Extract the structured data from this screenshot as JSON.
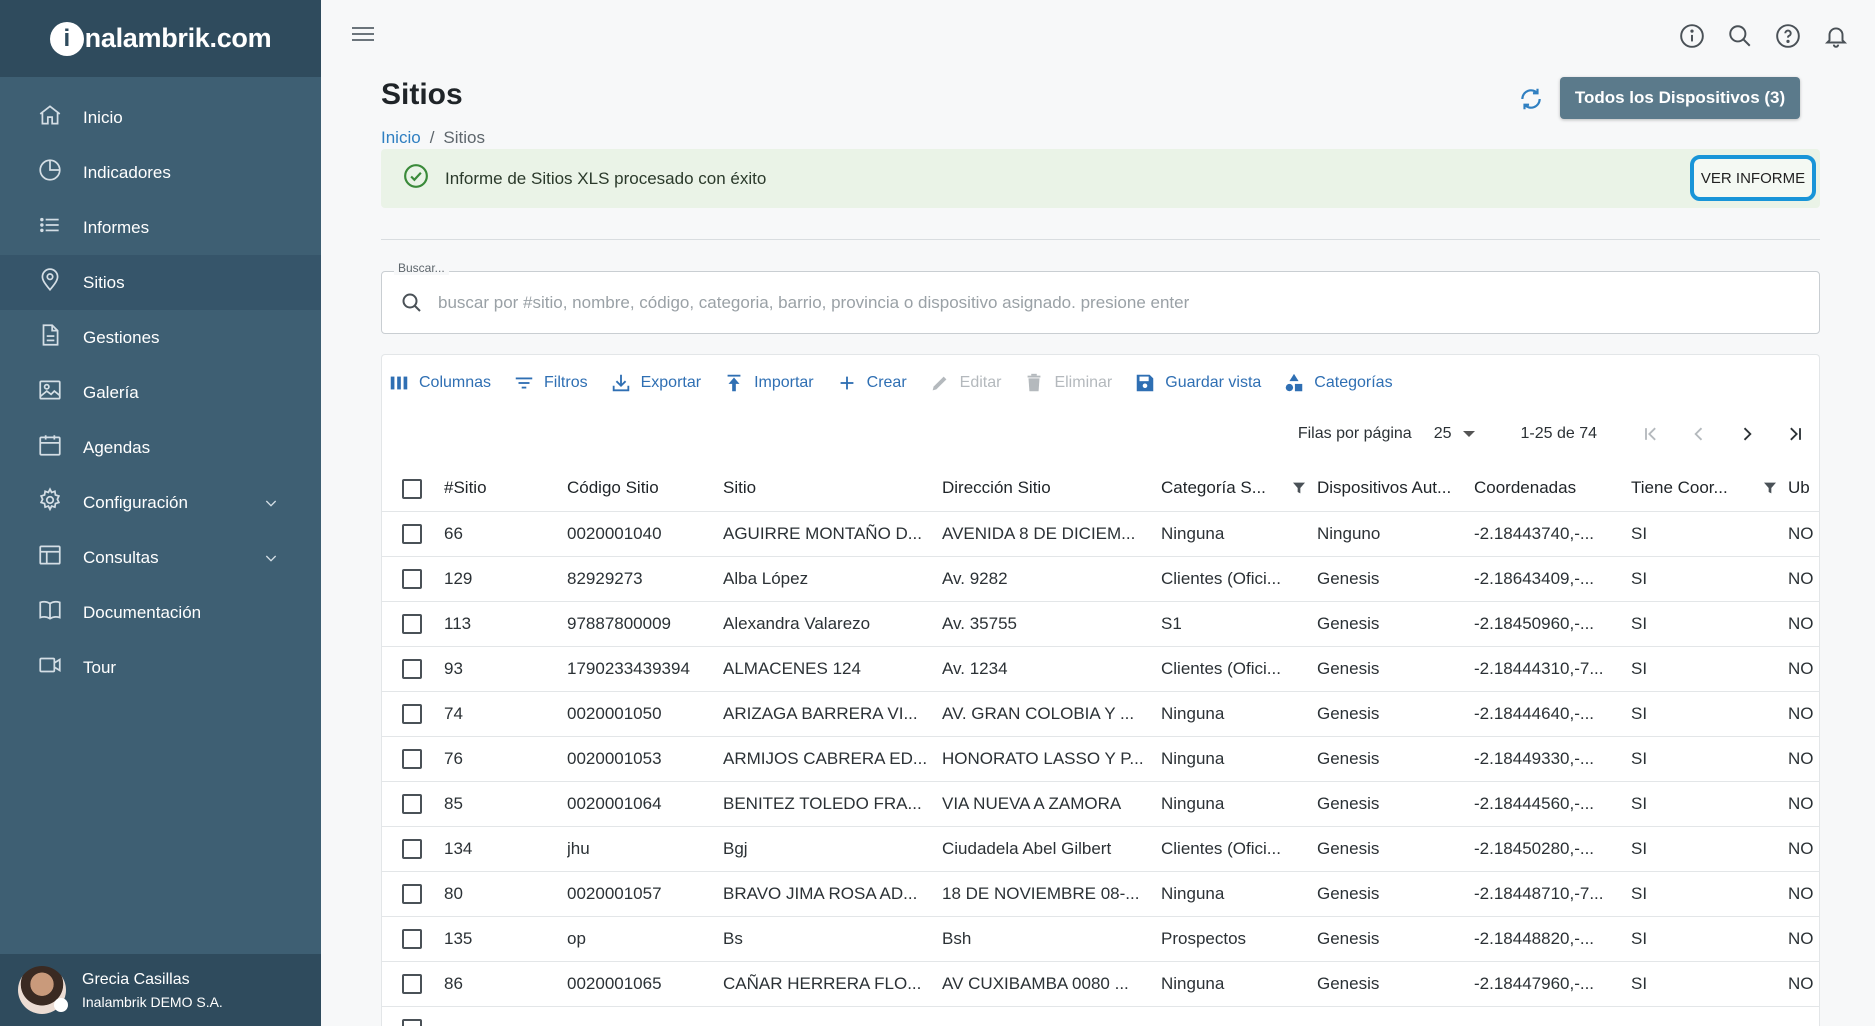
{
  "brand": {
    "logo_initial": "i",
    "logo_rest": "nalambrik.com"
  },
  "sidebar": {
    "items": [
      {
        "label": "Inicio",
        "icon": "home-icon"
      },
      {
        "label": "Indicadores",
        "icon": "pie-chart-icon"
      },
      {
        "label": "Informes",
        "icon": "list-icon"
      },
      {
        "label": "Sitios",
        "icon": "location-pin-icon",
        "active": true
      },
      {
        "label": "Gestiones",
        "icon": "document-icon"
      },
      {
        "label": "Galería",
        "icon": "image-icon"
      },
      {
        "label": "Agendas",
        "icon": "calendar-icon"
      },
      {
        "label": "Configuración",
        "icon": "gear-icon",
        "expandable": true
      },
      {
        "label": "Consultas",
        "icon": "table-icon",
        "expandable": true
      },
      {
        "label": "Documentación",
        "icon": "book-icon"
      },
      {
        "label": "Tour",
        "icon": "video-icon"
      }
    ],
    "user": {
      "name": "Grecia Casillas",
      "company": "Inalambrik DEMO S.A."
    }
  },
  "header": {
    "title": "Sitios",
    "breadcrumb": {
      "home": "Inicio",
      "separator": "/",
      "current": "Sitios"
    },
    "devices_button": "Todos los Dispositivos (3)"
  },
  "alert": {
    "text": "Informe de Sitios XLS procesado con éxito",
    "button": "VER INFORME"
  },
  "search": {
    "label": "Buscar...",
    "placeholder": "buscar por #sitio, nombre, código, categoria, barrio, provincia o dispositivo asignado. presione enter"
  },
  "toolbar": {
    "columns": "Columnas",
    "filters": "Filtros",
    "export": "Exportar",
    "import": "Importar",
    "create": "Crear",
    "edit": "Editar",
    "delete": "Eliminar",
    "save_view": "Guardar vista",
    "categories": "Categorías"
  },
  "pagination": {
    "rows_label": "Filas por página",
    "rows_value": "25",
    "range": "1-25 de 74"
  },
  "table": {
    "columns": [
      "#Sitio",
      "Código Sitio",
      "Sitio",
      "Dirección Sitio",
      "Categoría S...",
      "Dispositivos Aut...",
      "Coordenadas",
      "Tiene Coor...",
      "Ub"
    ],
    "rows": [
      [
        "66",
        "0020001040",
        "AGUIRRE MONTAÑO D...",
        "AVENIDA 8 DE DICIEM...",
        "Ninguna",
        "Ninguno",
        "-2.18443740,-...",
        "SI",
        "NO"
      ],
      [
        "129",
        "82929273",
        "Alba López",
        "Av. 9282",
        "Clientes (Ofici...",
        "Genesis",
        "-2.18643409,-...",
        "SI",
        "NO"
      ],
      [
        "113",
        "97887800009",
        "Alexandra Valarezo",
        "Av. 35755",
        "S1",
        "Genesis",
        "-2.18450960,-...",
        "SI",
        "NO"
      ],
      [
        "93",
        "1790233439394",
        "ALMACENES 124",
        "Av. 1234",
        "Clientes (Ofici...",
        "Genesis",
        "-2.18444310,-7...",
        "SI",
        "NO"
      ],
      [
        "74",
        "0020001050",
        "ARIZAGA BARRERA VI...",
        "AV. GRAN COLOBIA Y ...",
        "Ninguna",
        "Genesis",
        "-2.18444640,-...",
        "SI",
        "NO"
      ],
      [
        "76",
        "0020001053",
        "ARMIJOS CABRERA ED...",
        "HONORATO LASSO Y P...",
        "Ninguna",
        "Genesis",
        "-2.18449330,-...",
        "SI",
        "NO"
      ],
      [
        "85",
        "0020001064",
        "BENITEZ TOLEDO FRA...",
        "VIA NUEVA A ZAMORA",
        "Ninguna",
        "Genesis",
        "-2.18444560,-...",
        "SI",
        "NO"
      ],
      [
        "134",
        "jhu",
        "Bgj",
        "Ciudadela Abel Gilbert",
        "Clientes (Ofici...",
        "Genesis",
        "-2.18450280,-...",
        "SI",
        "NO"
      ],
      [
        "80",
        "0020001057",
        "BRAVO JIMA ROSA AD...",
        "18 DE NOVIEMBRE 08-...",
        "Ninguna",
        "Genesis",
        "-2.18448710,-7...",
        "SI",
        "NO"
      ],
      [
        "135",
        "op",
        "Bs",
        "Bsh",
        "Prospectos",
        "Genesis",
        "-2.18448820,-...",
        "SI",
        "NO"
      ],
      [
        "86",
        "0020001065",
        "CAÑAR HERRERA FLO...",
        "AV CUXIBAMBA 0080 ...",
        "Ninguna",
        "Genesis",
        "-2.18447960,-...",
        "SI",
        "NO"
      ],
      [
        "",
        "",
        "",
        "",
        "",
        "",
        "",
        "",
        ""
      ]
    ]
  },
  "colors": {
    "sidebar": "#3e5f73",
    "sidebar_dark": "#2f4b5d",
    "accent": "#2f7fc1",
    "alert_bg": "#eaf3e7",
    "focus_ring": "#1895d8"
  }
}
